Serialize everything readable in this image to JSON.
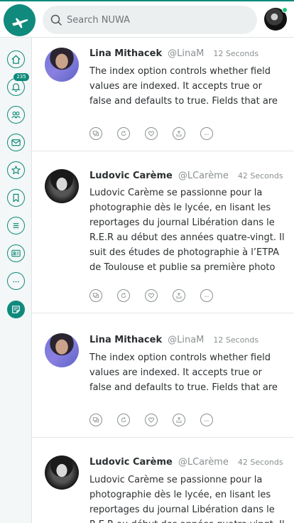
{
  "search": {
    "placeholder": "Search NUWA"
  },
  "sidebar": {
    "notification_count": "235",
    "items": [
      {
        "icon": "home-icon"
      },
      {
        "icon": "bell-icon"
      },
      {
        "icon": "people-icon"
      },
      {
        "icon": "mail-icon"
      },
      {
        "icon": "star-icon"
      },
      {
        "icon": "bookmark-icon"
      },
      {
        "icon": "list-icon"
      },
      {
        "icon": "id-card-icon"
      },
      {
        "icon": "more-icon"
      },
      {
        "icon": "compose-icon"
      }
    ]
  },
  "colors": {
    "accent": "#0f8a7c",
    "online": "#19c37d",
    "muted": "#8a9092"
  },
  "posts": [
    {
      "name": "Lina Mithacek",
      "handle": "@LinaM",
      "time": "12 Seconds",
      "text": "The index option controls whether field values are indexed. It accepts true or false and defaults to true. Fields that are not"
    },
    {
      "name": "Ludovic Carème",
      "handle": "@LCarème",
      "time": "42 Seconds",
      "text": "Ludovic Carème se passionne pour la photographie dès le lycée, en lisant les reportages du journal Libération dans le R.E.R au début des années quatre-vingt. Il suit des études de photographie à l’ETPA de Toulouse et publie sa première photo dans"
    },
    {
      "name": "Lina Mithacek",
      "handle": "@LinaM",
      "time": "12 Seconds",
      "text": "The index option controls whether field values are indexed. It accepts true or false and defaults to true. Fields that are not"
    },
    {
      "name": "Ludovic Carème",
      "handle": "@LCarème",
      "time": "42 Seconds",
      "text": "Ludovic Carème se passionne pour la photographie dès le lycée, en lisant les reportages du journal Libération dans le R.E.R au début des années quatre-vingt. Il"
    }
  ]
}
